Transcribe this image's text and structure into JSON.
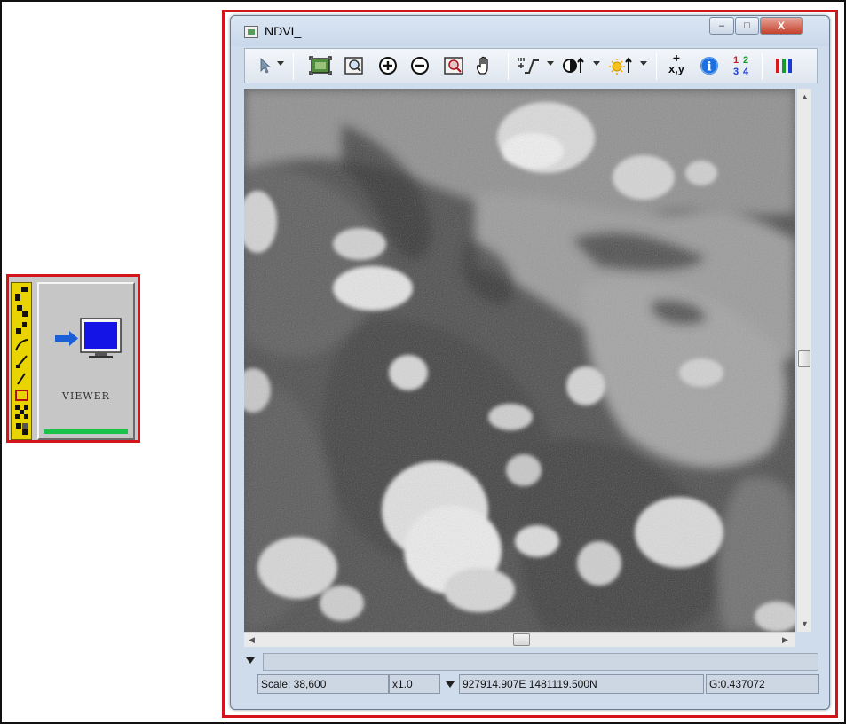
{
  "tool_panel": {
    "label": "VIEWER",
    "accent_color": "#d4141a"
  },
  "viewer_window": {
    "title": "NDVI_",
    "caption_buttons": {
      "minimize": "–",
      "maximize": "□",
      "close": "X"
    },
    "toolbar": [
      {
        "name": "select-pointer-icon",
        "has_dropdown": true
      },
      {
        "name": "zoom-to-extent-icon"
      },
      {
        "name": "zoom-to-data-icon"
      },
      {
        "name": "zoom-in-icon"
      },
      {
        "name": "zoom-out-icon"
      },
      {
        "name": "zoom-box-icon"
      },
      {
        "name": "pan-hand-icon"
      },
      {
        "name": "histogram-stretch-icon",
        "has_dropdown": true
      },
      {
        "name": "contrast-icon",
        "has_dropdown": true
      },
      {
        "name": "brightness-icon",
        "has_dropdown": true
      },
      {
        "name": "xy-coordinates-icon",
        "label": "x,y"
      },
      {
        "name": "info-icon",
        "label": "i"
      },
      {
        "name": "numeric-values-icon",
        "label": "1 2 3 4"
      },
      {
        "name": "band-combination-icon"
      }
    ],
    "status_bar": {
      "scale": "Scale: 38,600",
      "zoom": "x1.0",
      "coordinates": "927914.907E 1481119.500N",
      "pixel_value": "G:0.437072"
    }
  },
  "colors": {
    "highlight_border": "#d4141a",
    "tool_strip": "#e8d400",
    "progress_bar": "#19c24b",
    "monitor_screen": "#1414e6"
  }
}
